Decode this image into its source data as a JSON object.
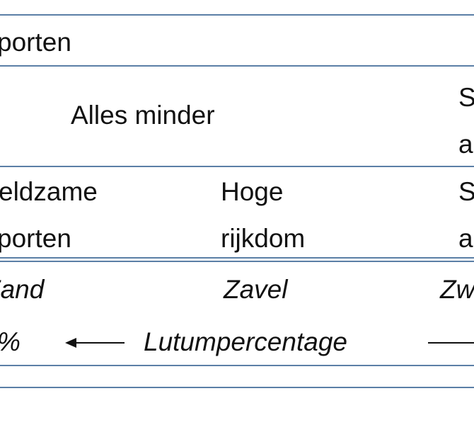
{
  "colors": {
    "rule": "#5b7fa6",
    "text": "#111111"
  },
  "row1": {
    "col1": "porten"
  },
  "row2": {
    "col2": "Alles minder",
    "col3_line1": "S",
    "col3_line2": "a"
  },
  "row3": {
    "col1_line1": "eldzame",
    "col1_line2": "porten",
    "col2_line1": "Hoge",
    "col2_line2": "rijkdom",
    "col3_line1": "S",
    "col3_line2": "a"
  },
  "soil_row": {
    "col1": "Zand",
    "col2": "Zavel",
    "col3": "Zw"
  },
  "axis_row": {
    "left_value": "%",
    "label": "Lutumpercentage",
    "left_arrow_icon": "arrow-left-icon"
  }
}
